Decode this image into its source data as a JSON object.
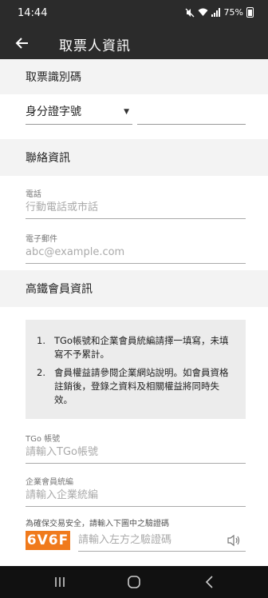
{
  "status": {
    "time": "14:44",
    "battery": "75%"
  },
  "appbar": {
    "title": "取票人資訊"
  },
  "ticket_id": {
    "section_title": "取票識別碼",
    "select_value": "身分證字號",
    "number_value": ""
  },
  "contact": {
    "section_title": "聯絡資訊",
    "phone_label": "電話",
    "phone_placeholder": "行動電話或市話",
    "email_label": "電子郵件",
    "email_placeholder": "abc@example.com"
  },
  "membership": {
    "section_title": "高鐵會員資訊",
    "notices": [
      {
        "num": "1.",
        "text": "TGo帳號和企業會員統編請擇一填寫，未填寫不予累計。"
      },
      {
        "num": "2.",
        "text": "會員權益請參閱企業網站說明。如會員資格註銷後，登錄之資料及相關權益將同時失效。"
      }
    ],
    "tgo_label": "TGo 帳號",
    "tgo_placeholder": "請輸入TGo帳號",
    "corp_label": "企業會員統編",
    "corp_placeholder": "請輸入企業統編"
  },
  "captcha": {
    "label": "為確保交易安全，請輸入下圖中之驗證碼",
    "code": "6V6F",
    "placeholder": "請輸入左方之驗證碼",
    "code_color": "#f07a1c"
  },
  "icons": {
    "back": "back-arrow-icon",
    "speaker": "speaker-icon",
    "recent": "recent-apps-icon",
    "home": "home-icon",
    "nav_back": "nav-back-icon"
  }
}
